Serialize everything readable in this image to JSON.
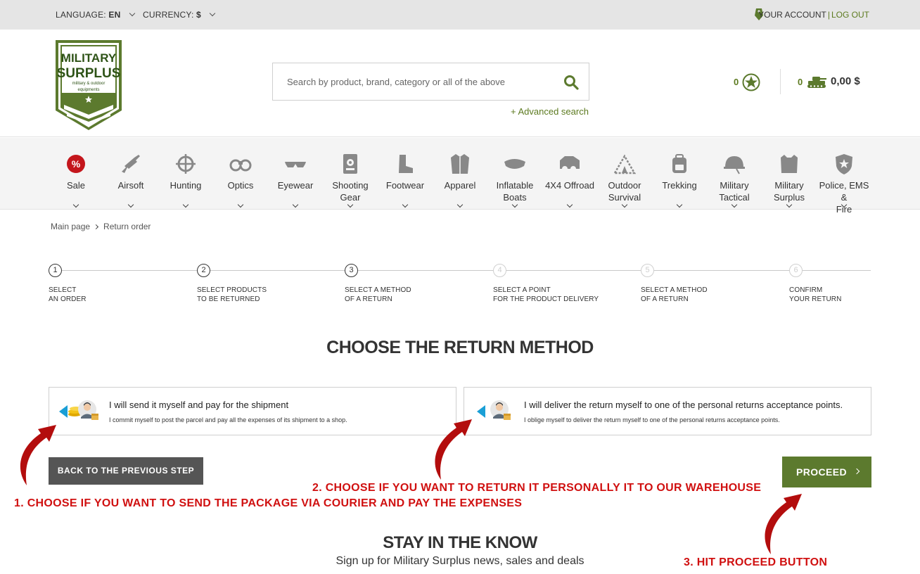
{
  "topbar": {
    "language_label": "LANGUAGE:",
    "language_value": "EN",
    "currency_label": "CURRENCY:",
    "currency_value": "$",
    "account_label": "YOUR ACCOUNT",
    "account_sep": "|",
    "logout_label": "LOG OUT"
  },
  "header": {
    "logo_text_1": "MILITARY",
    "logo_text_2": "SURPLUS",
    "logo_text_3": "military & outdoor",
    "logo_text_4": "equipments",
    "search_placeholder": "Search by product, brand, category or all of the above",
    "advanced_search": "+ Advanced search",
    "favorites_count": "0",
    "cart_count": "0",
    "cart_total": "0,00 $"
  },
  "categories": [
    {
      "label_1": "Sale",
      "label_2": "",
      "icon": "sale-icon"
    },
    {
      "label_1": "Airsoft",
      "label_2": "",
      "icon": "rifle-icon"
    },
    {
      "label_1": "Hunting",
      "label_2": "",
      "icon": "crosshair-icon"
    },
    {
      "label_1": "Optics",
      "label_2": "",
      "icon": "binoculars-icon"
    },
    {
      "label_1": "Eyewear",
      "label_2": "",
      "icon": "sunglasses-icon"
    },
    {
      "label_1": "Shooting",
      "label_2": "Gear",
      "icon": "target-badge-icon"
    },
    {
      "label_1": "Footwear",
      "label_2": "",
      "icon": "boot-icon"
    },
    {
      "label_1": "Apparel",
      "label_2": "",
      "icon": "jacket-icon"
    },
    {
      "label_1": "Inflatable",
      "label_2": "Boats",
      "icon": "boat-icon"
    },
    {
      "label_1": "4X4 Offroad",
      "label_2": "",
      "icon": "offroad-icon"
    },
    {
      "label_1": "Outdoor",
      "label_2": "Survival",
      "icon": "tent-icon"
    },
    {
      "label_1": "Trekking",
      "label_2": "",
      "icon": "backpack-icon"
    },
    {
      "label_1": "Military",
      "label_2": "Tactical",
      "icon": "helmet-icon"
    },
    {
      "label_1": "Military",
      "label_2": "Surplus",
      "icon": "vest-icon"
    },
    {
      "label_1": "Police, EMS &",
      "label_2": "Fire",
      "icon": "badge-icon"
    }
  ],
  "breadcrumb": {
    "home": "Main page",
    "current": "Return order"
  },
  "steps": [
    {
      "num": "1",
      "line1": "SELECT",
      "line2": "AN ORDER",
      "active": true
    },
    {
      "num": "2",
      "line1": "SELECT PRODUCTS",
      "line2": "TO BE RETURNED",
      "active": true
    },
    {
      "num": "3",
      "line1": "SELECT A METHOD",
      "line2": "OF A RETURN",
      "active": true
    },
    {
      "num": "4",
      "line1": "SELECT A POINT",
      "line2": "FOR THE PRODUCT DELIVERY",
      "active": false
    },
    {
      "num": "5",
      "line1": "SELECT A METHOD",
      "line2": "OF A RETURN",
      "active": false
    },
    {
      "num": "6",
      "line1": "CONFIRM",
      "line2": "YOUR RETURN",
      "active": false
    }
  ],
  "main": {
    "title": "CHOOSE THE RETURN METHOD",
    "option1_title": "I will send it myself and pay for the shipment",
    "option1_desc": "I commit myself to post the parcel and pay all the expenses of its shipment to a shop.",
    "option2_title": "I will deliver the return myself to one of the personal returns acceptance points.",
    "option2_desc": "I oblige myself to deliver the return myself to one of the personal returns acceptance points.",
    "back_button": "BACK TO THE PREVIOUS STEP",
    "proceed_button": "PROCEED"
  },
  "annotations": {
    "note1": "1. CHOOSE IF YOU WANT TO SEND THE PACKAGE VIA COURIER AND PAY THE EXPENSES",
    "note2": "2. CHOOSE IF YOU WANT TO RETURN IT PERSONALLY IT TO OUR WAREHOUSE",
    "note3": "3. HIT PROCEED BUTTON"
  },
  "newsletter": {
    "title": "STAY IN THE KNOW",
    "subtitle": "Sign up for Military Surplus news, sales and deals"
  },
  "colors": {
    "brand_green": "#5c7a2e",
    "annotation_red": "#d01010",
    "back_button_bg": "#555555"
  }
}
